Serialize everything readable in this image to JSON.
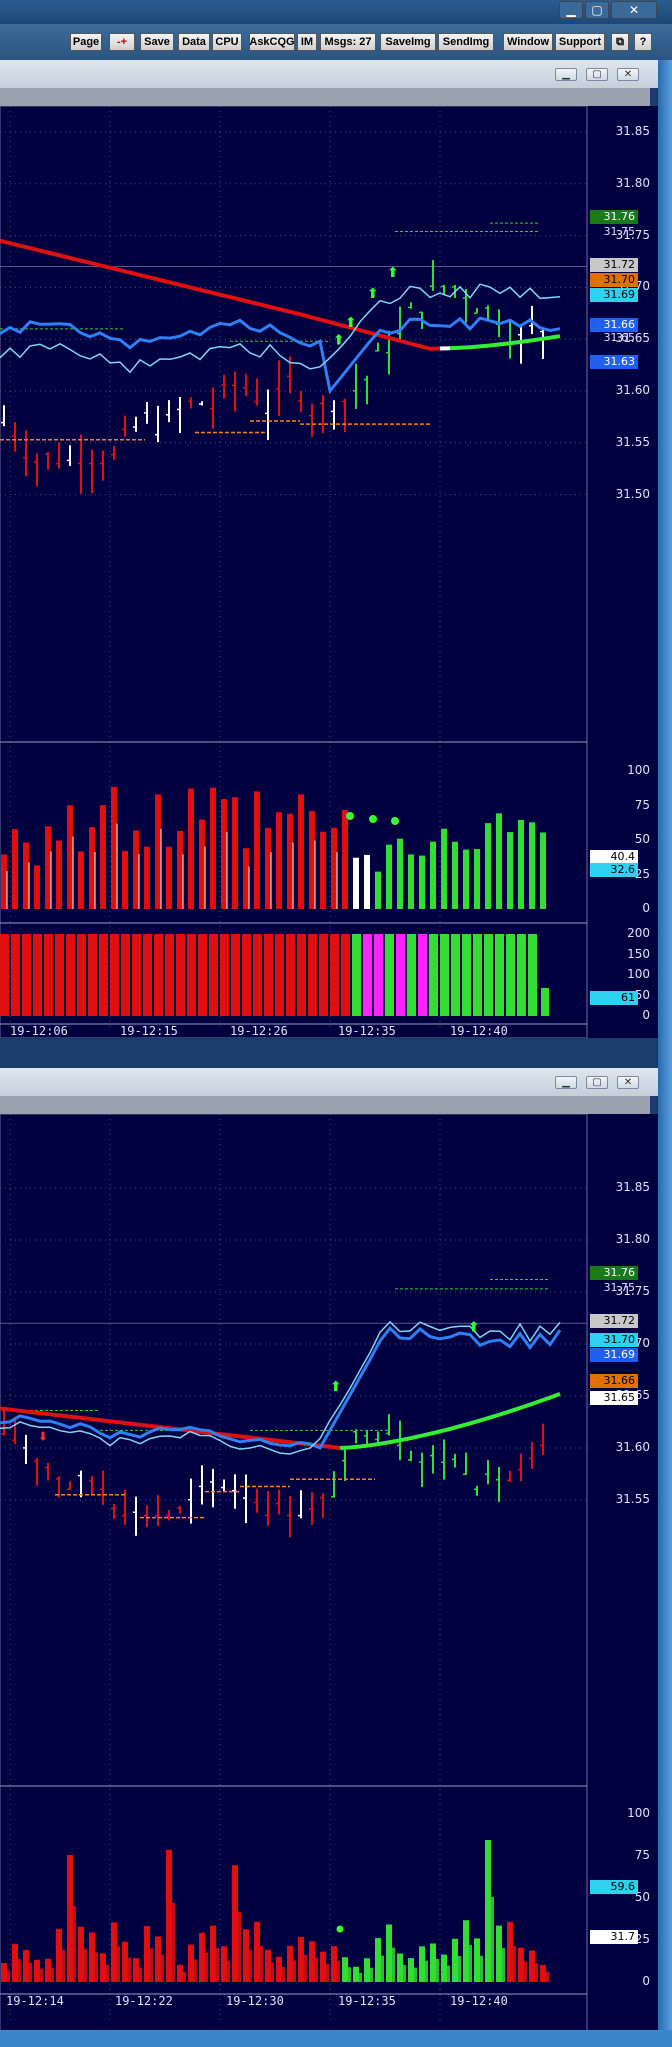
{
  "toolbar": {
    "buttons": [
      "Page",
      "-+",
      "Save",
      "Data",
      "CPU",
      "AskCQG",
      "IM",
      "Msgs: 27",
      "SaveImg",
      "SendImg",
      "Window",
      "Support"
    ]
  },
  "icons": {
    "window_minimize": "minimize-icon",
    "window_maximize": "maximize-icon",
    "window_close": "close-icon",
    "restore": "restore-icon",
    "help": "help-icon"
  },
  "colors": {
    "background": "#000040",
    "bull": "#33dd33",
    "bear": "#e01010",
    "neutral": "#ffffff",
    "ma_long": "#e01010",
    "ma_long_up": "#33ee33",
    "band_fast": "#2f7ff5",
    "band_slow": "#7fd6f5",
    "magenta": "#ff22ff"
  },
  "chart1": {
    "price_axis": [
      "31.85",
      "31.80",
      "31.75",
      "31.70",
      "31.65",
      "31.60",
      "31.55",
      "31.50"
    ],
    "tags": [
      {
        "text": "31.76",
        "bg": "#1a7a1a",
        "fg": "#ffffff"
      },
      {
        "text": "31.75",
        "bg": "",
        "fg": "#e0e0ff"
      },
      {
        "text": "31.72",
        "bg": "#c8c8c8",
        "fg": "#000000"
      },
      {
        "text": "31.70",
        "bg": "#e07000",
        "fg": "#000000"
      },
      {
        "text": "31.69",
        "bg": "#30d0f0",
        "fg": "#000000"
      },
      {
        "text": "31.66",
        "bg": "#2060f0",
        "fg": "#ffffff"
      },
      {
        "text": "31.65",
        "bg": "",
        "fg": "#e0e0ff"
      },
      {
        "text": "31.63",
        "bg": "#2060f0",
        "fg": "#ffffff"
      }
    ],
    "volume_axis": [
      "100",
      "75",
      "50",
      "25",
      "0"
    ],
    "volume_tags": [
      {
        "text": "40.4",
        "bg": "#ffffff",
        "fg": "#000000"
      },
      {
        "text": "32.6",
        "bg": "#30d0f0",
        "fg": "#000000"
      }
    ],
    "osc_axis": [
      "200",
      "150",
      "100",
      "50",
      "0"
    ],
    "osc_tag": {
      "text": "61",
      "bg": "#30d0f0",
      "fg": "#000000"
    },
    "time_labels": [
      "19-12:06",
      "19-12:15",
      "19-12:26",
      "19-12:35",
      "19-12:40"
    ]
  },
  "chart2": {
    "price_axis": [
      "31.85",
      "31.80",
      "31.75",
      "31.70",
      "31.65",
      "31.60",
      "31.55"
    ],
    "tags": [
      {
        "text": "31.76",
        "bg": "#1a7a1a",
        "fg": "#ffffff"
      },
      {
        "text": "31.75",
        "bg": "",
        "fg": "#e0e0ff"
      },
      {
        "text": "31.72",
        "bg": "#c8c8c8",
        "fg": "#000000"
      },
      {
        "text": "31.70",
        "bg": "#30d0f0",
        "fg": "#000000"
      },
      {
        "text": "31.69",
        "bg": "#2060f0",
        "fg": "#ffffff"
      },
      {
        "text": "31.66",
        "bg": "#e07000",
        "fg": "#000000"
      },
      {
        "text": "31.65",
        "bg": "#ffffff",
        "fg": "#000000"
      }
    ],
    "volume_axis": [
      "100",
      "75",
      "50",
      "25",
      "0"
    ],
    "volume_tags": [
      {
        "text": "59.6",
        "bg": "#30d0f0",
        "fg": "#000000"
      },
      {
        "text": "31.7",
        "bg": "#ffffff",
        "fg": "#000000"
      }
    ],
    "time_labels": [
      "19-12:14",
      "19-12:22",
      "19-12:30",
      "19-12:35",
      "19-12:40"
    ]
  }
}
